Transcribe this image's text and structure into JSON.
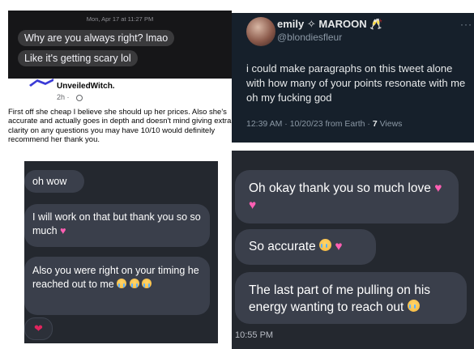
{
  "imessage": {
    "timestamp": "Mon, Apr 17 at 11:27 PM",
    "messages": [
      "Why are you always right? lmao",
      "Like it's getting scary lol"
    ]
  },
  "tweet": {
    "display_name": "emily ✧ MAROON 🥂",
    "handle": "@blondiesfleur",
    "more": "···",
    "body": "i could make paragraphs on this tweet alone with how many of your points resonate with me oh my fucking god",
    "time": "12:39 AM · 10/20/23 from Earth · ",
    "views_count": "7",
    "views_label": " Views"
  },
  "facebook": {
    "username": "UnveiledWitch.",
    "time": "2h ·",
    "review": "First off she cheap I believe she should up her prices. Also she's accurate and actually goes in depth and doesn't mind giving extra clarity on any questions you may have 10/10 would definitely recommend her thank you."
  },
  "chat_small": {
    "messages": [
      "oh wow",
      "I will work on that but thank you so so much",
      "Also you were right on your timing he reached out to me"
    ],
    "reaction": "❤"
  },
  "chat_large": {
    "messages": [
      "Oh okay thank you so much love",
      "So accurate",
      "The last part of me pulling on his energy wanting to reach out"
    ],
    "timestamp": "10:55 PM"
  },
  "colors": {
    "imessage_bg": "#161618",
    "twitter_bg": "#16202b",
    "chat_bg": "#24282f",
    "bubble": "#3a3f4b",
    "heart_pink": "#ff5fb3"
  }
}
